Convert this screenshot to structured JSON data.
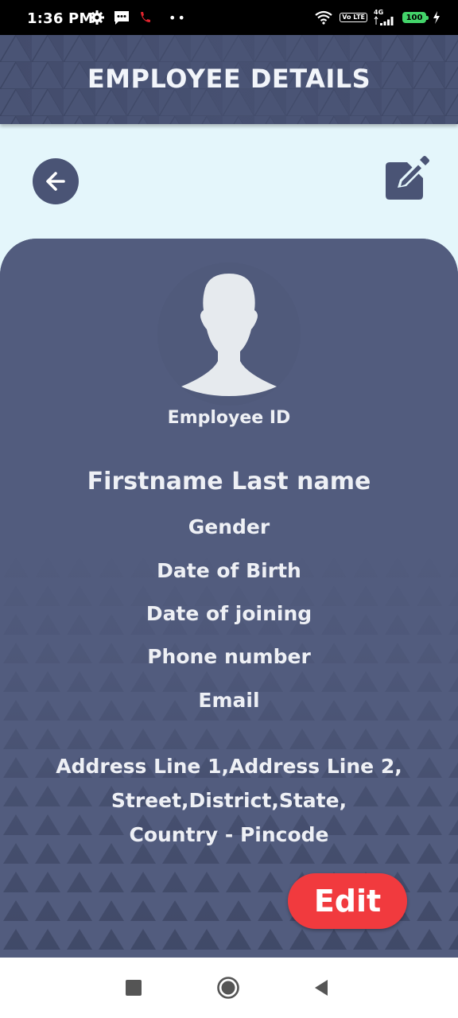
{
  "status_bar": {
    "time": "1:36 PM",
    "network_label": "4G",
    "lte_label": "Vo LTE",
    "battery_level": "100"
  },
  "header": {
    "title": "EMPLOYEE DETAILS"
  },
  "actions": {
    "back_icon": "arrow-left-icon",
    "edit_icon": "pencil-square-icon"
  },
  "employee": {
    "employee_id_label": "Employee ID",
    "name": "Firstname Last name",
    "gender": "Gender",
    "date_of_birth": "Date of Birth",
    "date_of_joining": "Date of joining",
    "phone": "Phone number",
    "email": "Email",
    "address_lines": [
      "Address Line 1,Address Line 2,",
      "Street,District,State,",
      "Country - Pincode"
    ]
  },
  "edit_button": {
    "label": "Edit"
  },
  "colors": {
    "primary": "#4a5475",
    "card": "#525c7e",
    "background": "#e4f6fb",
    "accent": "#f13a3e",
    "text_light": "#eef0f5"
  },
  "nav": {
    "recents_icon": "square-icon",
    "home_icon": "circle-icon",
    "back_icon": "triangle-back-icon"
  }
}
